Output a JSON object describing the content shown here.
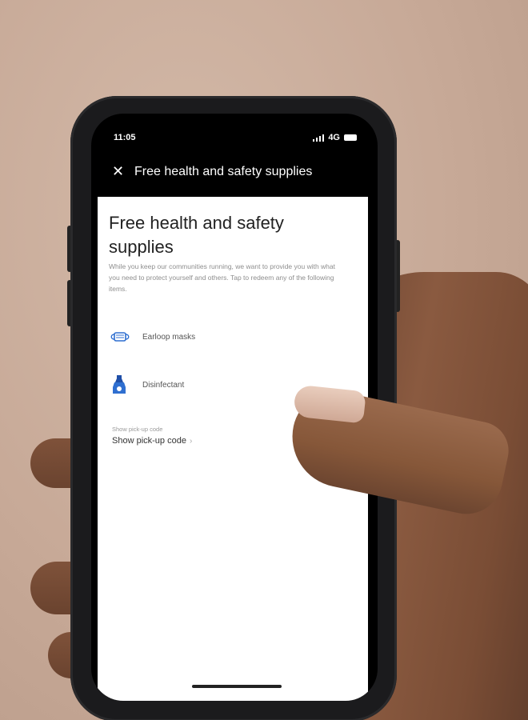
{
  "status_bar": {
    "time": "11:05",
    "network": "4G"
  },
  "nav": {
    "close_icon": "close-icon",
    "title": "Free health and safety supplies"
  },
  "main": {
    "heading": "Free health and safety supplies",
    "description": "While you keep our communities running, we want to provide you with what you need to protect yourself and others. Tap to redeem any of the following items.",
    "items": [
      {
        "label": "Earloop masks",
        "icon": "mask-icon"
      },
      {
        "label": "Disinfectant",
        "icon": "spray-bottle-icon"
      }
    ],
    "pickup": {
      "caption": "Show pick-up code",
      "link": "Show pick-up code"
    }
  },
  "colors": {
    "accent_blue": "#2f6fd0",
    "nav_background": "#000000",
    "content_background": "#ffffff"
  }
}
